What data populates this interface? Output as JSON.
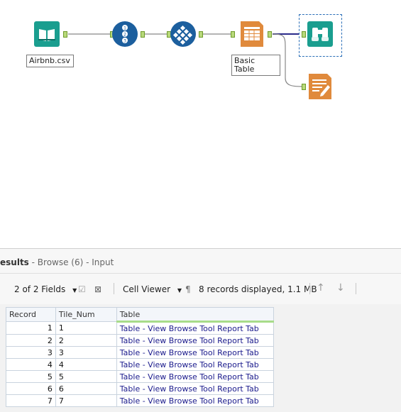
{
  "workflow": {
    "input_label": "Airbnb.csv",
    "table_label": "Basic Table"
  },
  "results": {
    "title_fragment": "esults",
    "subtitle": " - Browse (6) - Input",
    "fields_selector": "2 of 2 Fields",
    "cell_viewer": "Cell Viewer",
    "records_info": "8 records displayed, 1.1 MB",
    "columns": [
      "Record",
      "Tile_Num",
      "Table"
    ],
    "rows": [
      [
        "1",
        "1",
        "Table - View Browse Tool Report Tab"
      ],
      [
        "2",
        "2",
        "Table - View Browse Tool Report Tab"
      ],
      [
        "3",
        "3",
        "Table - View Browse Tool Report Tab"
      ],
      [
        "4",
        "4",
        "Table - View Browse Tool Report Tab"
      ],
      [
        "5",
        "5",
        "Table - View Browse Tool Report Tab"
      ],
      [
        "6",
        "6",
        "Table - View Browse Tool Report Tab"
      ],
      [
        "7",
        "7",
        "Table - View Browse Tool Report Tab"
      ]
    ]
  },
  "colors": {
    "input_tool": "#1a9e8f",
    "tile_tool": "#1c5f9e",
    "report_tool": "#e08a3c",
    "browse_tool": "#1a9e8f"
  }
}
